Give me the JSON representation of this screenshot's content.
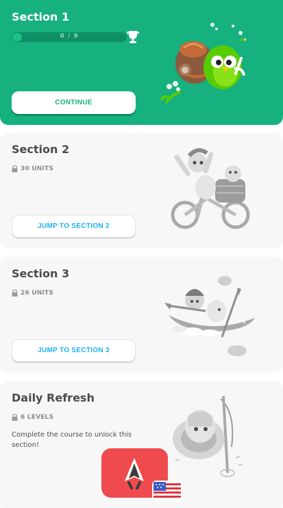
{
  "sections": [
    {
      "title": "Section 1",
      "progress_text": "0 / 9",
      "progress_fraction": 0,
      "button_label": "CONTINUE",
      "accent_color": "#17b07f"
    },
    {
      "title": "Section 2",
      "meta": "30 UNITS",
      "button_label": "JUMP TO SECTION 2"
    },
    {
      "title": "Section 3",
      "meta": "26 UNITS",
      "button_label": "JUMP TO SECTION 3"
    },
    {
      "title": "Daily Refresh",
      "meta": "6 LEVELS",
      "locked_message": "Complete the course to unlock this section!"
    }
  ],
  "colors": {
    "green": "#17b07f",
    "link_blue": "#1cb0f6",
    "card_gray": "#f7f7f7",
    "badge_red": "#ef4a4e"
  }
}
